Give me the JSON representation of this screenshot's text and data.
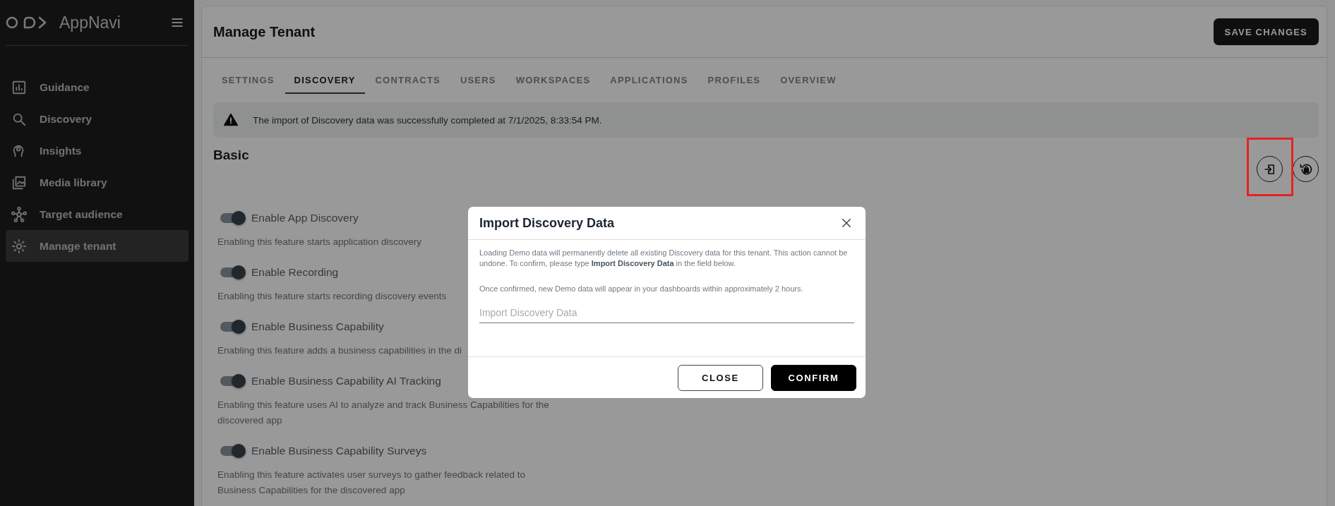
{
  "sidebar": {
    "logo": "AppNavi",
    "items": [
      {
        "label": "Guidance",
        "selected": false
      },
      {
        "label": "Discovery",
        "selected": false
      },
      {
        "label": "Insights",
        "selected": false
      },
      {
        "label": "Media library",
        "selected": false
      },
      {
        "label": "Target audience",
        "selected": false
      },
      {
        "label": "Manage tenant",
        "selected": true
      }
    ]
  },
  "page": {
    "title": "Manage Tenant",
    "save_button": "SAVE CHANGES",
    "tabs": [
      {
        "label": "SETTINGS",
        "selected": false
      },
      {
        "label": "DISCOVERY",
        "selected": true
      },
      {
        "label": "CONTRACTS",
        "selected": false
      },
      {
        "label": "USERS",
        "selected": false
      },
      {
        "label": "WORKSPACES",
        "selected": false
      },
      {
        "label": "APPLICATIONS",
        "selected": false
      },
      {
        "label": "PROFILES",
        "selected": false
      },
      {
        "label": "OVERVIEW",
        "selected": false
      }
    ],
    "alert": "The import of Discovery data was successfully completed at 7/1/2025, 8:33:54 PM.",
    "section_title": "Basic",
    "features": [
      {
        "label": "Enable App Discovery",
        "on": true,
        "description": "Enabling this feature starts application discovery"
      },
      {
        "label": "Enable Recording",
        "on": true,
        "description": "Enabling this feature starts recording discovery events"
      },
      {
        "label": "Enable Business Capability",
        "on": true,
        "description": "Enabling this feature adds a business capabilities in the di"
      },
      {
        "label": "Enable Business Capability AI Tracking",
        "on": true,
        "description": "Enabling this feature uses AI to analyze and track Business Capabilities for the discovered app"
      },
      {
        "label": "Enable Business Capability Surveys",
        "on": true,
        "description": "Enabling this feature activates user surveys to gather feedback related to Business Capabilities for the discovered app"
      }
    ]
  },
  "dialog": {
    "title": "Import Discovery Data",
    "message": "Loading Demo data will permanently delete all existing Discovery data for this tenant. This action cannot be undone. To confirm, please type **Import Discovery Data** in the field below.",
    "note": "Once confirmed, new Demo data will appear in your dashboards within approximately 2 hours.",
    "input": {
      "placeholder": "Import Discovery Data"
    },
    "buttons": [
      {
        "label": "CLOSE",
        "kind": "secondary"
      },
      {
        "label": "CONFIRM",
        "kind": "primary"
      }
    ]
  }
}
